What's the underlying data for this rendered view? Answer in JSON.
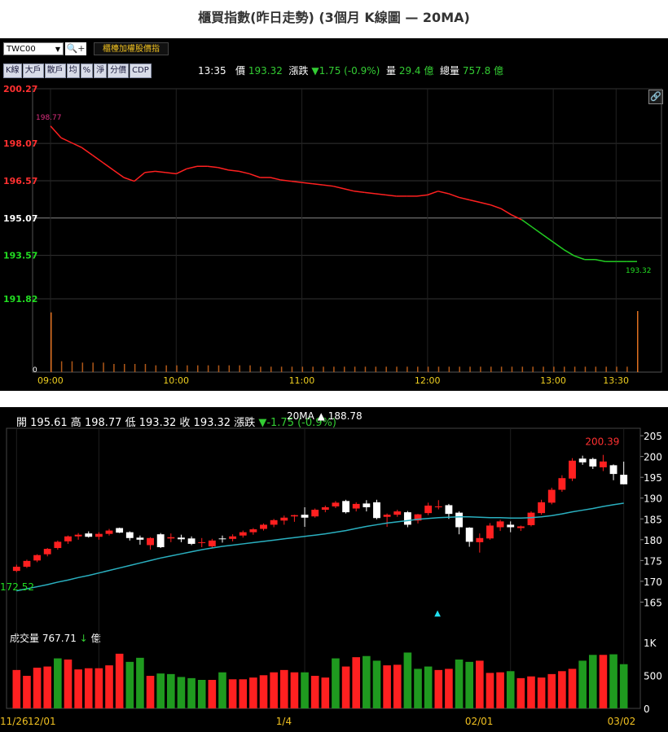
{
  "title": "櫃買指數(昨日走勢) (3個月 K線圖 — 20MA)",
  "toolbar": {
    "symbol": "TWC00",
    "search_icon": "magnifier-plus-icon",
    "gold_button": "櫃檯加權股價指",
    "tabs": [
      "K線",
      "大戶",
      "散戶",
      "均",
      "%",
      "淨",
      "分價",
      "CDP"
    ]
  },
  "status": {
    "time": "13:35",
    "price_label": "價",
    "price": "193.32",
    "change_label": "漲跌",
    "change": "▼1.75 (-0.9%)",
    "qty_label": "量",
    "qty": "29.4 億",
    "total_label": "總量",
    "total": "757.8 億"
  },
  "colors": {
    "up": "#ff2020",
    "down": "#22cc22",
    "ma": "#2ab0c0",
    "volume": "#d07020"
  },
  "intraday_chart": {
    "type": "line",
    "ylim": [
      191.82,
      200.27
    ],
    "reference": 195.07,
    "ytick_labels": [
      "200.27",
      "198.07",
      "196.57",
      "195.07",
      "193.57",
      "191.82"
    ],
    "yticks": [
      200.27,
      198.07,
      196.57,
      195.07,
      193.57,
      191.82
    ],
    "xtick_labels": [
      "09:00",
      "10:00",
      "11:00",
      "12:00",
      "13:00",
      "13:30"
    ],
    "xticks": [
      0,
      60,
      120,
      180,
      240,
      270
    ],
    "open_label": "198.77",
    "last_label": "193.32",
    "x_minutes": [
      0,
      5,
      10,
      15,
      20,
      25,
      30,
      35,
      40,
      45,
      50,
      55,
      60,
      65,
      70,
      75,
      80,
      85,
      90,
      95,
      100,
      105,
      110,
      115,
      120,
      125,
      130,
      135,
      140,
      145,
      150,
      155,
      160,
      165,
      170,
      175,
      180,
      185,
      190,
      195,
      200,
      205,
      210,
      215,
      220,
      225,
      230,
      235,
      240,
      245,
      250,
      255,
      260,
      265,
      270,
      275,
      280
    ],
    "prices": [
      198.77,
      198.3,
      198.1,
      197.9,
      197.6,
      197.3,
      197.0,
      196.7,
      196.55,
      196.9,
      196.95,
      196.9,
      196.85,
      197.05,
      197.15,
      197.15,
      197.1,
      197.0,
      196.95,
      196.85,
      196.7,
      196.7,
      196.6,
      196.55,
      196.5,
      196.45,
      196.4,
      196.35,
      196.25,
      196.15,
      196.1,
      196.05,
      196.0,
      195.95,
      195.95,
      195.95,
      196.0,
      196.15,
      196.05,
      195.9,
      195.8,
      195.7,
      195.6,
      195.45,
      195.2,
      195.0,
      194.7,
      194.4,
      194.1,
      193.8,
      193.55,
      193.4,
      193.4,
      193.32,
      193.32,
      193.32,
      193.32
    ],
    "volume_bars": [
      44,
      8,
      8,
      7,
      7,
      7,
      6,
      6,
      6,
      6,
      5,
      5,
      5,
      5,
      5,
      5,
      5,
      5,
      5,
      5,
      4,
      4,
      4,
      4,
      4,
      4,
      4,
      4,
      4,
      4,
      4,
      4,
      4,
      4,
      4,
      4,
      4,
      4,
      4,
      4,
      4,
      4,
      4,
      4,
      4,
      4,
      4,
      4,
      4,
      4,
      4,
      4,
      4,
      4,
      4,
      4,
      45
    ],
    "volume_zero_label": "0"
  },
  "kline_chart": {
    "type": "candlestick",
    "ohlc_text": {
      "open_label": "開",
      "open": "195.61",
      "high_label": "高",
      "high": "198.77",
      "low_label": "低",
      "low": "193.32",
      "close_label": "收",
      "close": "193.32",
      "change_label": "漲跌",
      "change": "▼-1.75 (-0.9%)"
    },
    "ma_label": "20MA ▲ 188.78",
    "ylim": [
      160,
      206
    ],
    "ytick_labels": [
      "205",
      "200",
      "195",
      "190",
      "185",
      "180",
      "175",
      "170",
      "165"
    ],
    "yticks": [
      205,
      200,
      195,
      190,
      185,
      180,
      175,
      170,
      165
    ],
    "xtick_labels": [
      "11/26",
      "12/01",
      "1/4",
      "02/01",
      "03/02"
    ],
    "high_annotation": "200.39",
    "low_annotation": "172.52",
    "marker": "▲",
    "candles": [
      [
        172.5,
        174.0,
        172.2,
        173.5
      ],
      [
        173.5,
        175.2,
        173.2,
        174.9
      ],
      [
        175.0,
        176.5,
        174.6,
        176.3
      ],
      [
        176.5,
        178.0,
        176.0,
        177.8
      ],
      [
        178.0,
        179.8,
        177.6,
        179.5
      ],
      [
        179.6,
        181.0,
        179.0,
        180.8
      ],
      [
        180.8,
        181.6,
        180.0,
        181.2
      ],
      [
        181.5,
        182.0,
        180.5,
        180.7
      ],
      [
        180.7,
        181.8,
        180.0,
        181.4
      ],
      [
        181.4,
        182.6,
        181.0,
        182.2
      ],
      [
        182.8,
        182.9,
        181.6,
        181.7
      ],
      [
        181.8,
        182.0,
        179.8,
        180.4
      ],
      [
        180.5,
        181.0,
        178.8,
        180.0
      ],
      [
        178.7,
        180.6,
        177.6,
        180.4
      ],
      [
        181.3,
        181.6,
        178.0,
        178.2
      ],
      [
        180.3,
        181.5,
        179.4,
        180.6
      ],
      [
        180.5,
        181.2,
        179.4,
        180.1
      ],
      [
        180.3,
        180.8,
        178.7,
        179.0
      ],
      [
        179.2,
        180.4,
        178.2,
        179.4
      ],
      [
        178.4,
        180.2,
        177.9,
        179.8
      ],
      [
        180.3,
        181.0,
        179.3,
        180.2
      ],
      [
        180.2,
        181.3,
        179.6,
        180.8
      ],
      [
        181.0,
        182.2,
        180.5,
        181.8
      ],
      [
        181.8,
        182.8,
        181.2,
        182.5
      ],
      [
        182.6,
        183.9,
        182.2,
        183.6
      ],
      [
        183.6,
        185.0,
        183.0,
        184.7
      ],
      [
        184.6,
        185.8,
        183.6,
        185.3
      ],
      [
        185.6,
        186.0,
        184.3,
        185.9
      ],
      [
        186.0,
        187.8,
        183.1,
        185.3
      ],
      [
        185.6,
        187.5,
        185.3,
        187.2
      ],
      [
        187.2,
        188.2,
        186.6,
        187.8
      ],
      [
        188.0,
        189.3,
        187.6,
        188.9
      ],
      [
        189.3,
        189.6,
        186.3,
        186.6
      ],
      [
        187.5,
        189.0,
        186.8,
        188.6
      ],
      [
        188.7,
        189.5,
        186.8,
        187.8
      ],
      [
        189.0,
        189.6,
        184.9,
        185.2
      ],
      [
        185.5,
        186.3,
        183.1,
        186.0
      ],
      [
        186.0,
        187.2,
        185.5,
        186.8
      ],
      [
        186.6,
        186.9,
        183.0,
        183.6
      ],
      [
        184.6,
        186.2,
        183.9,
        186.1
      ],
      [
        186.4,
        188.9,
        185.9,
        188.2
      ],
      [
        187.8,
        189.5,
        187.3,
        188.0
      ],
      [
        188.3,
        188.6,
        185.0,
        186.2
      ],
      [
        186.5,
        186.8,
        181.3,
        183.0
      ],
      [
        182.9,
        183.0,
        178.3,
        179.5
      ],
      [
        179.4,
        181.5,
        176.9,
        180.4
      ],
      [
        180.3,
        184.0,
        180.0,
        183.4
      ],
      [
        183.0,
        184.8,
        182.1,
        184.4
      ],
      [
        183.6,
        184.4,
        181.8,
        183.0
      ],
      [
        182.8,
        183.4,
        182.1,
        183.2
      ],
      [
        183.5,
        186.8,
        183.2,
        186.5
      ],
      [
        186.4,
        189.6,
        186.0,
        189.0
      ],
      [
        188.9,
        192.5,
        188.5,
        192.0
      ],
      [
        192.0,
        195.5,
        191.5,
        194.8
      ],
      [
        194.7,
        199.6,
        194.1,
        199.0
      ],
      [
        199.5,
        200.2,
        198.0,
        198.6
      ],
      [
        199.4,
        199.7,
        197.0,
        197.6
      ],
      [
        197.4,
        200.39,
        196.5,
        198.8
      ],
      [
        197.9,
        198.1,
        194.3,
        195.8
      ],
      [
        195.61,
        198.77,
        193.32,
        193.32
      ]
    ],
    "ma20": [
      167.7,
      168.2,
      168.7,
      169.2,
      169.8,
      170.3,
      170.9,
      171.4,
      172.0,
      172.6,
      173.2,
      173.8,
      174.4,
      175.0,
      175.6,
      176.1,
      176.6,
      177.1,
      177.6,
      178.0,
      178.4,
      178.7,
      179.0,
      179.3,
      179.6,
      179.9,
      180.2,
      180.5,
      180.8,
      181.1,
      181.4,
      181.8,
      182.2,
      182.7,
      183.2,
      183.6,
      184.0,
      184.3,
      184.6,
      184.9,
      185.1,
      185.3,
      185.4,
      185.5,
      185.5,
      185.4,
      185.3,
      185.3,
      185.2,
      185.2,
      185.3,
      185.5,
      185.8,
      186.2,
      186.7,
      187.1,
      187.5,
      188.0,
      188.4,
      188.78
    ],
    "volume_label": "成交量",
    "volume_value": "767.71",
    "volume_arrow": "↓",
    "volume_unit": "億",
    "vol_ytick_labels": [
      "1K",
      "500",
      "0"
    ],
    "vol_yticks": [
      1000,
      500,
      0
    ],
    "vol_ylim": [
      0,
      1050
    ],
    "volume": [
      660,
      560,
      700,
      720,
      860,
      840,
      670,
      690,
      690,
      740,
      940,
      800,
      870,
      560,
      600,
      590,
      540,
      520,
      490,
      490,
      620,
      500,
      500,
      530,
      570,
      620,
      660,
      620,
      620,
      560,
      530,
      860,
      720,
      880,
      900,
      820,
      740,
      750,
      960,
      680,
      720,
      660,
      680,
      840,
      800,
      820,
      610,
      620,
      640,
      520,
      550,
      530,
      590,
      640,
      680,
      820,
      920,
      920,
      930,
      760
    ],
    "volume_down_flags": [
      0,
      0,
      0,
      0,
      1,
      0,
      0,
      0,
      0,
      0,
      0,
      1,
      1,
      0,
      1,
      1,
      1,
      1,
      1,
      0,
      1,
      0,
      0,
      0,
      0,
      0,
      0,
      0,
      1,
      0,
      0,
      1,
      0,
      0,
      1,
      1,
      0,
      0,
      1,
      1,
      1,
      0,
      0,
      1,
      1,
      0,
      0,
      0,
      1,
      0,
      0,
      0,
      0,
      0,
      0,
      1,
      1,
      0,
      1,
      1
    ]
  }
}
